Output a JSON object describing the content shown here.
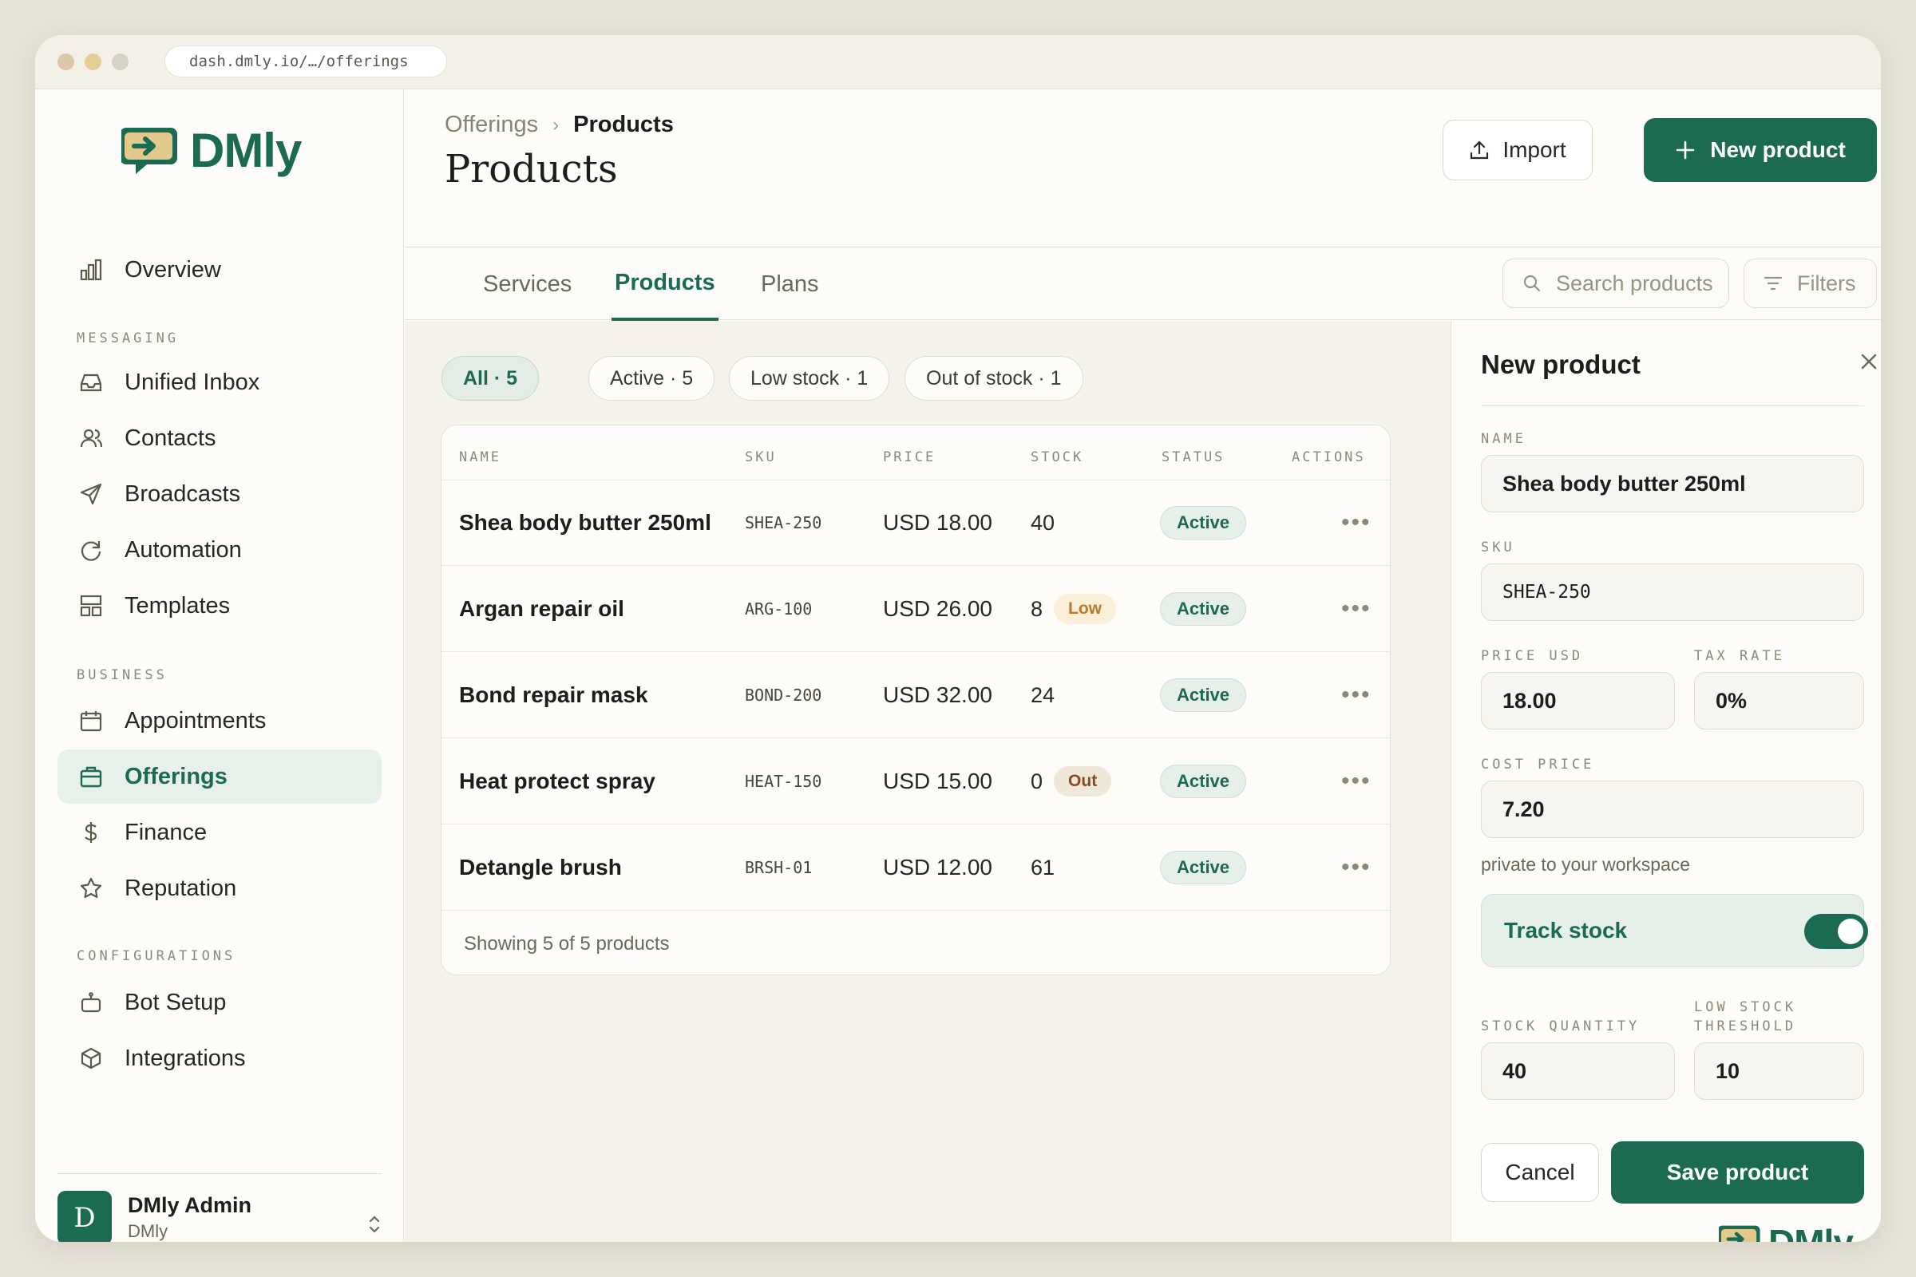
{
  "browser": {
    "url": "dash.dmly.io/…/offerings"
  },
  "brand": {
    "name": "DMly",
    "accent": "#1a6b52",
    "logo_icon": "chat-bubble-arrow-icon"
  },
  "sidebar": {
    "overview": {
      "label": "Overview",
      "icon": "bar-chart-icon"
    },
    "sections": [
      {
        "label": "MESSAGING",
        "items": [
          {
            "label": "Unified Inbox",
            "icon": "inbox-icon"
          },
          {
            "label": "Contacts",
            "icon": "users-icon"
          },
          {
            "label": "Broadcasts",
            "icon": "send-icon"
          },
          {
            "label": "Automation",
            "icon": "refresh-icon"
          },
          {
            "label": "Templates",
            "icon": "layout-icon"
          }
        ]
      },
      {
        "label": "BUSINESS",
        "items": [
          {
            "label": "Appointments",
            "icon": "calendar-icon"
          },
          {
            "label": "Offerings",
            "icon": "briefcase-icon",
            "active": true
          },
          {
            "label": "Finance",
            "icon": "dollar-icon"
          },
          {
            "label": "Reputation",
            "icon": "star-icon"
          }
        ]
      },
      {
        "label": "CONFIGURATIONS",
        "items": [
          {
            "label": "Bot Setup",
            "icon": "bot-icon"
          },
          {
            "label": "Integrations",
            "icon": "box-icon"
          }
        ]
      }
    ],
    "user": {
      "initial": "D",
      "name": "DMly Admin",
      "org": "DMly"
    }
  },
  "header": {
    "breadcrumb": {
      "parent": "Offerings",
      "separator": "›",
      "current": "Products"
    },
    "title": "Products",
    "import_label": "Import",
    "new_label": "New product"
  },
  "tabs": [
    {
      "label": "Services"
    },
    {
      "label": "Products",
      "active": true
    },
    {
      "label": "Plans"
    }
  ],
  "search": {
    "placeholder": "Search products"
  },
  "filters_label": "Filters",
  "filter_pills": [
    {
      "label": "All · 5",
      "active": true
    },
    {
      "label": "Active · 5"
    },
    {
      "label": "Low stock · 1"
    },
    {
      "label": "Out of stock · 1"
    }
  ],
  "table": {
    "columns": [
      "NAME",
      "SKU",
      "PRICE",
      "STOCK",
      "STATUS",
      "ACTIONS"
    ],
    "rows": [
      {
        "name": "Shea body butter 250ml",
        "sku": "SHEA-250",
        "price": "USD 18.00",
        "stock": "40",
        "stock_flag": "",
        "status": "Active"
      },
      {
        "name": "Argan repair oil",
        "sku": "ARG-100",
        "price": "USD 26.00",
        "stock": "8",
        "stock_flag": "Low",
        "status": "Active"
      },
      {
        "name": "Bond repair mask",
        "sku": "BOND-200",
        "price": "USD 32.00",
        "stock": "24",
        "stock_flag": "",
        "status": "Active"
      },
      {
        "name": "Heat protect spray",
        "sku": "HEAT-150",
        "price": "USD 15.00",
        "stock": "0",
        "stock_flag": "Out",
        "status": "Active"
      },
      {
        "name": "Detangle brush",
        "sku": "BRSH-01",
        "price": "USD 12.00",
        "stock": "61",
        "stock_flag": "",
        "status": "Active"
      }
    ],
    "actions_glyph": "•••",
    "footer": "Showing 5 of 5 products"
  },
  "panel": {
    "title": "New product",
    "name_label": "NAME",
    "name_value": "Shea body butter 250ml",
    "sku_label": "SKU",
    "sku_value": "SHEA-250",
    "price_label": "PRICE USD",
    "price_value": "18.00",
    "tax_label": "TAX RATE",
    "tax_value": "0%",
    "cost_label": "COST PRICE",
    "cost_value": "7.20",
    "cost_hint": "private to your workspace",
    "track_label": "Track stock",
    "track_on": true,
    "qty_label": "STOCK QUANTITY",
    "qty_value": "40",
    "low_label_line1": "LOW STOCK",
    "low_label_line2": "THRESHOLD",
    "low_value": "10",
    "cancel_label": "Cancel",
    "save_label": "Save product"
  }
}
